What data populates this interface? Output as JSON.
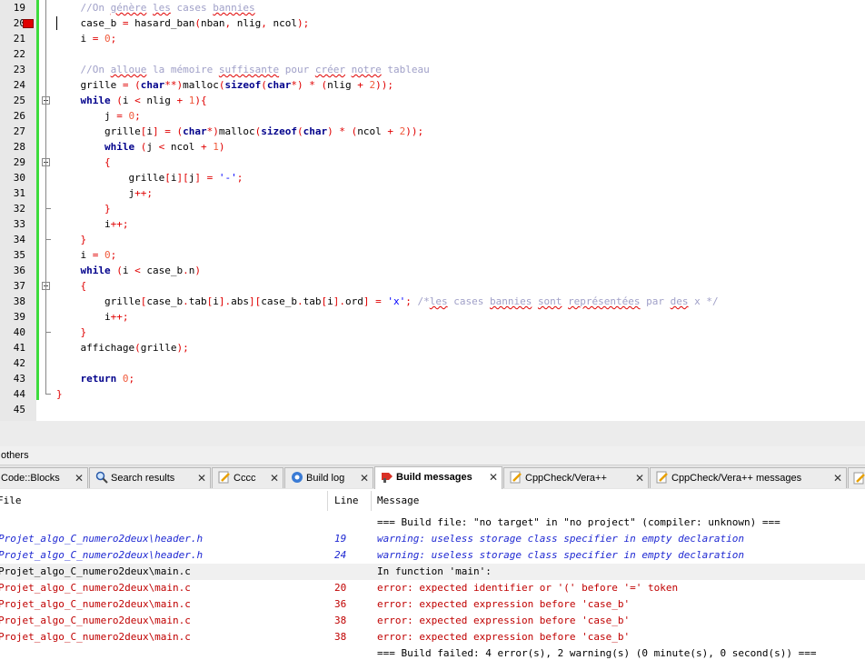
{
  "editor": {
    "lines": [
      {
        "n": "19",
        "tokens": [
          {
            "t": "    ",
            "c": ""
          },
          {
            "t": "//On ",
            "c": "cm"
          },
          {
            "t": "génère",
            "c": "cm sq"
          },
          {
            "t": " ",
            "c": "cm"
          },
          {
            "t": "les",
            "c": "cm sq"
          },
          {
            "t": " cases ",
            "c": "cm"
          },
          {
            "t": "bannies",
            "c": "cm sq"
          }
        ]
      },
      {
        "n": "20",
        "breakpoint": true,
        "caret": true,
        "tokens": [
          {
            "t": "    case_b ",
            "c": ""
          },
          {
            "t": "=",
            "c": "op"
          },
          {
            "t": " hasard_ban",
            "c": ""
          },
          {
            "t": "(",
            "c": "op"
          },
          {
            "t": "nban",
            "c": ""
          },
          {
            "t": ",",
            "c": "op"
          },
          {
            "t": " nlig",
            "c": ""
          },
          {
            "t": ",",
            "c": "op"
          },
          {
            "t": " ncol",
            "c": ""
          },
          {
            "t": ");",
            "c": "op"
          }
        ]
      },
      {
        "n": "21",
        "tokens": [
          {
            "t": "    i ",
            "c": ""
          },
          {
            "t": "=",
            "c": "op"
          },
          {
            "t": " ",
            "c": ""
          },
          {
            "t": "0",
            "c": "num"
          },
          {
            "t": ";",
            "c": "op"
          }
        ]
      },
      {
        "n": "22",
        "tokens": []
      },
      {
        "n": "23",
        "tokens": [
          {
            "t": "    ",
            "c": ""
          },
          {
            "t": "//On ",
            "c": "cm"
          },
          {
            "t": "alloue",
            "c": "cm sq"
          },
          {
            "t": " la mémoire ",
            "c": "cm"
          },
          {
            "t": "suffisante",
            "c": "cm sq"
          },
          {
            "t": " pour ",
            "c": "cm"
          },
          {
            "t": "créer",
            "c": "cm sq"
          },
          {
            "t": " ",
            "c": "cm"
          },
          {
            "t": "notre",
            "c": "cm sq"
          },
          {
            "t": " tableau",
            "c": "cm"
          }
        ]
      },
      {
        "n": "24",
        "tokens": [
          {
            "t": "    grille ",
            "c": ""
          },
          {
            "t": "=",
            "c": "op"
          },
          {
            "t": " ",
            "c": ""
          },
          {
            "t": "(",
            "c": "op"
          },
          {
            "t": "char",
            "c": "kw"
          },
          {
            "t": "**)",
            "c": "op"
          },
          {
            "t": "malloc",
            "c": ""
          },
          {
            "t": "(",
            "c": "op"
          },
          {
            "t": "sizeof",
            "c": "kw"
          },
          {
            "t": "(",
            "c": "op"
          },
          {
            "t": "char",
            "c": "kw"
          },
          {
            "t": "*)",
            "c": "op"
          },
          {
            "t": " ",
            "c": ""
          },
          {
            "t": "*",
            "c": "op"
          },
          {
            "t": " ",
            "c": ""
          },
          {
            "t": "(",
            "c": "op"
          },
          {
            "t": "nlig ",
            "c": ""
          },
          {
            "t": "+",
            "c": "op"
          },
          {
            "t": " ",
            "c": ""
          },
          {
            "t": "2",
            "c": "num"
          },
          {
            "t": "));",
            "c": "op"
          }
        ]
      },
      {
        "n": "25",
        "fold": "start",
        "tokens": [
          {
            "t": "    ",
            "c": ""
          },
          {
            "t": "while",
            "c": "kw"
          },
          {
            "t": " ",
            "c": ""
          },
          {
            "t": "(",
            "c": "op"
          },
          {
            "t": "i ",
            "c": ""
          },
          {
            "t": "<",
            "c": "op"
          },
          {
            "t": " nlig ",
            "c": ""
          },
          {
            "t": "+",
            "c": "op"
          },
          {
            "t": " ",
            "c": ""
          },
          {
            "t": "1",
            "c": "num"
          },
          {
            "t": "){",
            "c": "op"
          }
        ]
      },
      {
        "n": "26",
        "tokens": [
          {
            "t": "        j ",
            "c": ""
          },
          {
            "t": "=",
            "c": "op"
          },
          {
            "t": " ",
            "c": ""
          },
          {
            "t": "0",
            "c": "num"
          },
          {
            "t": ";",
            "c": "op"
          }
        ]
      },
      {
        "n": "27",
        "tokens": [
          {
            "t": "        grille",
            "c": ""
          },
          {
            "t": "[",
            "c": "op"
          },
          {
            "t": "i",
            "c": ""
          },
          {
            "t": "]",
            "c": "op"
          },
          {
            "t": " ",
            "c": ""
          },
          {
            "t": "=",
            "c": "op"
          },
          {
            "t": " ",
            "c": ""
          },
          {
            "t": "(",
            "c": "op"
          },
          {
            "t": "char",
            "c": "kw"
          },
          {
            "t": "*)",
            "c": "op"
          },
          {
            "t": "malloc",
            "c": ""
          },
          {
            "t": "(",
            "c": "op"
          },
          {
            "t": "sizeof",
            "c": "kw"
          },
          {
            "t": "(",
            "c": "op"
          },
          {
            "t": "char",
            "c": "kw"
          },
          {
            "t": ")",
            "c": "op"
          },
          {
            "t": " ",
            "c": ""
          },
          {
            "t": "*",
            "c": "op"
          },
          {
            "t": " ",
            "c": ""
          },
          {
            "t": "(",
            "c": "op"
          },
          {
            "t": "ncol ",
            "c": ""
          },
          {
            "t": "+",
            "c": "op"
          },
          {
            "t": " ",
            "c": ""
          },
          {
            "t": "2",
            "c": "num"
          },
          {
            "t": "));",
            "c": "op"
          }
        ]
      },
      {
        "n": "28",
        "tokens": [
          {
            "t": "        ",
            "c": ""
          },
          {
            "t": "while",
            "c": "kw"
          },
          {
            "t": " ",
            "c": ""
          },
          {
            "t": "(",
            "c": "op"
          },
          {
            "t": "j ",
            "c": ""
          },
          {
            "t": "<",
            "c": "op"
          },
          {
            "t": " ncol ",
            "c": ""
          },
          {
            "t": "+",
            "c": "op"
          },
          {
            "t": " ",
            "c": ""
          },
          {
            "t": "1",
            "c": "num"
          },
          {
            "t": ")",
            "c": "op"
          }
        ]
      },
      {
        "n": "29",
        "fold": "start",
        "tokens": [
          {
            "t": "        ",
            "c": ""
          },
          {
            "t": "{",
            "c": "op"
          }
        ]
      },
      {
        "n": "30",
        "tokens": [
          {
            "t": "            grille",
            "c": ""
          },
          {
            "t": "[",
            "c": "op"
          },
          {
            "t": "i",
            "c": ""
          },
          {
            "t": "][",
            "c": "op"
          },
          {
            "t": "j",
            "c": ""
          },
          {
            "t": "]",
            "c": "op"
          },
          {
            "t": " ",
            "c": ""
          },
          {
            "t": "=",
            "c": "op"
          },
          {
            "t": " ",
            "c": ""
          },
          {
            "t": "'-'",
            "c": "str"
          },
          {
            "t": ";",
            "c": "op"
          }
        ]
      },
      {
        "n": "31",
        "tokens": [
          {
            "t": "            j",
            "c": ""
          },
          {
            "t": "++;",
            "c": "op"
          }
        ]
      },
      {
        "n": "32",
        "fold": "end",
        "tokens": [
          {
            "t": "        ",
            "c": ""
          },
          {
            "t": "}",
            "c": "op"
          }
        ]
      },
      {
        "n": "33",
        "tokens": [
          {
            "t": "        i",
            "c": ""
          },
          {
            "t": "++;",
            "c": "op"
          }
        ]
      },
      {
        "n": "34",
        "fold": "end",
        "tokens": [
          {
            "t": "    ",
            "c": ""
          },
          {
            "t": "}",
            "c": "op"
          }
        ]
      },
      {
        "n": "35",
        "tokens": [
          {
            "t": "    i ",
            "c": ""
          },
          {
            "t": "=",
            "c": "op"
          },
          {
            "t": " ",
            "c": ""
          },
          {
            "t": "0",
            "c": "num"
          },
          {
            "t": ";",
            "c": "op"
          }
        ]
      },
      {
        "n": "36",
        "tokens": [
          {
            "t": "    ",
            "c": ""
          },
          {
            "t": "while",
            "c": "kw"
          },
          {
            "t": " ",
            "c": ""
          },
          {
            "t": "(",
            "c": "op"
          },
          {
            "t": "i ",
            "c": ""
          },
          {
            "t": "<",
            "c": "op"
          },
          {
            "t": " case_b",
            "c": ""
          },
          {
            "t": ".",
            "c": "op"
          },
          {
            "t": "n",
            "c": ""
          },
          {
            "t": ")",
            "c": "op"
          }
        ]
      },
      {
        "n": "37",
        "fold": "start",
        "tokens": [
          {
            "t": "    ",
            "c": ""
          },
          {
            "t": "{",
            "c": "op"
          }
        ]
      },
      {
        "n": "38",
        "tokens": [
          {
            "t": "        grille",
            "c": ""
          },
          {
            "t": "[",
            "c": "op"
          },
          {
            "t": "case_b",
            "c": ""
          },
          {
            "t": ".",
            "c": "op"
          },
          {
            "t": "tab",
            "c": ""
          },
          {
            "t": "[",
            "c": "op"
          },
          {
            "t": "i",
            "c": ""
          },
          {
            "t": "].",
            "c": "op"
          },
          {
            "t": "abs",
            "c": ""
          },
          {
            "t": "][",
            "c": "op"
          },
          {
            "t": "case_b",
            "c": ""
          },
          {
            "t": ".",
            "c": "op"
          },
          {
            "t": "tab",
            "c": ""
          },
          {
            "t": "[",
            "c": "op"
          },
          {
            "t": "i",
            "c": ""
          },
          {
            "t": "].",
            "c": "op"
          },
          {
            "t": "ord",
            "c": ""
          },
          {
            "t": "]",
            "c": "op"
          },
          {
            "t": " ",
            "c": ""
          },
          {
            "t": "=",
            "c": "op"
          },
          {
            "t": " ",
            "c": ""
          },
          {
            "t": "'x'",
            "c": "str"
          },
          {
            "t": ";",
            "c": "op"
          },
          {
            "t": " ",
            "c": ""
          },
          {
            "t": "/*",
            "c": "cm"
          },
          {
            "t": "les",
            "c": "cm sq"
          },
          {
            "t": " cases ",
            "c": "cm"
          },
          {
            "t": "bannies",
            "c": "cm sq"
          },
          {
            "t": " ",
            "c": "cm"
          },
          {
            "t": "sont",
            "c": "cm sq"
          },
          {
            "t": " ",
            "c": "cm"
          },
          {
            "t": "représentées",
            "c": "cm sq"
          },
          {
            "t": " par ",
            "c": "cm"
          },
          {
            "t": "des",
            "c": "cm sq"
          },
          {
            "t": " x */",
            "c": "cm"
          }
        ]
      },
      {
        "n": "39",
        "tokens": [
          {
            "t": "        i",
            "c": ""
          },
          {
            "t": "++;",
            "c": "op"
          }
        ]
      },
      {
        "n": "40",
        "fold": "end",
        "tokens": [
          {
            "t": "    ",
            "c": ""
          },
          {
            "t": "}",
            "c": "op"
          }
        ]
      },
      {
        "n": "41",
        "tokens": [
          {
            "t": "    affichage",
            "c": ""
          },
          {
            "t": "(",
            "c": "op"
          },
          {
            "t": "grille",
            "c": ""
          },
          {
            "t": ");",
            "c": "op"
          }
        ]
      },
      {
        "n": "42",
        "tokens": []
      },
      {
        "n": "43",
        "tokens": [
          {
            "t": "    ",
            "c": ""
          },
          {
            "t": "return",
            "c": "kw"
          },
          {
            "t": " ",
            "c": ""
          },
          {
            "t": "0",
            "c": "num"
          },
          {
            "t": ";",
            "c": "op"
          }
        ]
      },
      {
        "n": "44",
        "tokens": [
          {
            "t": "",
            "c": ""
          },
          {
            "t": "}",
            "c": "op"
          }
        ]
      },
      {
        "n": "45",
        "tokens": []
      }
    ]
  },
  "panel": {
    "title": "others",
    "tabs": [
      {
        "label": "Code::Blocks",
        "icon": "codeblocks-icon",
        "active": false
      },
      {
        "label": "Search results",
        "icon": "search-icon",
        "active": false
      },
      {
        "label": "Cccc",
        "icon": "edit-icon",
        "active": false
      },
      {
        "label": "Build log",
        "icon": "gear-icon",
        "active": false
      },
      {
        "label": "Build messages",
        "icon": "build-messages-icon",
        "active": true
      },
      {
        "label": "CppCheck/Vera++",
        "icon": "edit-icon",
        "active": false
      },
      {
        "label": "CppCheck/Vera++ messages",
        "icon": "edit-icon",
        "active": false
      }
    ],
    "close_glyph": "✕",
    "headers": {
      "file": "File",
      "line": "Line",
      "message": "Message"
    },
    "rows": [
      {
        "file": "",
        "line": "",
        "message": "=== Build file: \"no target\" in \"no project\" (compiler: unknown) ===",
        "type": "info"
      },
      {
        "file": "Projet_algo_C_numero2deux\\header.h",
        "line": "19",
        "message": "warning: useless storage class specifier in empty declaration",
        "type": "warn"
      },
      {
        "file": "Projet_algo_C_numero2deux\\header.h",
        "line": "24",
        "message": "warning: useless storage class specifier in empty declaration",
        "type": "warn"
      },
      {
        "file": "Projet_algo_C_numero2deux\\main.c",
        "line": "",
        "message": "In function 'main':",
        "type": "info",
        "selected": true
      },
      {
        "file": "Projet_algo_C_numero2deux\\main.c",
        "line": "20",
        "message": "error: expected identifier or '(' before '=' token",
        "type": "err"
      },
      {
        "file": "Projet_algo_C_numero2deux\\main.c",
        "line": "36",
        "message": "error: expected expression before 'case_b'",
        "type": "err"
      },
      {
        "file": "Projet_algo_C_numero2deux\\main.c",
        "line": "38",
        "message": "error: expected expression before 'case_b'",
        "type": "err"
      },
      {
        "file": "Projet_algo_C_numero2deux\\main.c",
        "line": "38",
        "message": "error: expected expression before 'case_b'",
        "type": "err"
      },
      {
        "file": "",
        "line": "",
        "message": "=== Build failed: 4 error(s), 2 warning(s) (0 minute(s), 0 second(s)) ===",
        "type": "info"
      }
    ]
  },
  "colors": {
    "keyword": "#00008b",
    "number": "#f05a3c",
    "operator": "#e00000",
    "string": "#0000ff",
    "comment": "#a0a0c8",
    "warning": "#1e28d2",
    "error": "#c00000",
    "change_bar": "#3ddc3d",
    "breakpoint": "#e00000"
  }
}
